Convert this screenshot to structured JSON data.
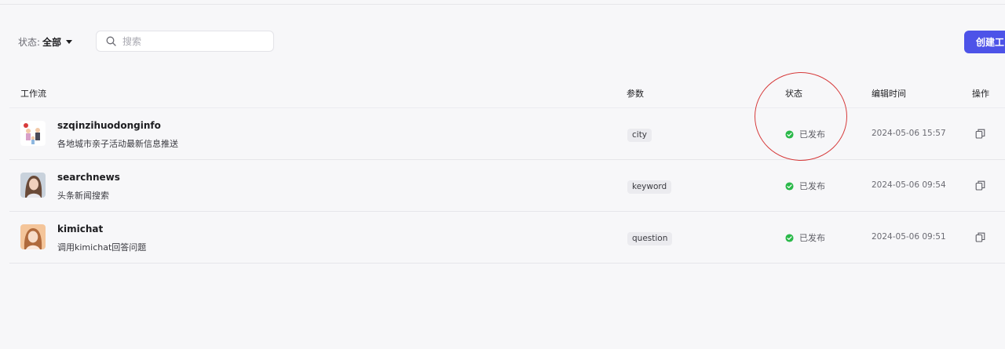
{
  "filter": {
    "label": "状态:",
    "value": "全部"
  },
  "search": {
    "placeholder": "搜索",
    "value": ""
  },
  "create_button": {
    "label": "创建工"
  },
  "table": {
    "headers": {
      "flow": "工作流",
      "param": "参数",
      "status": "状态",
      "edit_time": "编辑时间",
      "action": "操作"
    },
    "rows": [
      {
        "name": "szqinzihuodonginfo",
        "desc": "各地城市亲子活动最新信息推送",
        "param": "city",
        "status": "已发布",
        "time": "2024-05-06 15:57"
      },
      {
        "name": "searchnews",
        "desc": "头条新闻搜索",
        "param": "keyword",
        "status": "已发布",
        "time": "2024-05-06 09:54"
      },
      {
        "name": "kimichat",
        "desc": "调用kimichat回答问题",
        "param": "question",
        "status": "已发布",
        "time": "2024-05-06 09:51"
      }
    ]
  },
  "colors": {
    "accent": "#4d53e8",
    "published": "#2bb94a",
    "annotation": "#d63a3a"
  },
  "icons": {
    "search": "search-icon",
    "status": "check-circle-icon",
    "copy": "copy-icon",
    "filter_caret": "caret-down-icon"
  }
}
